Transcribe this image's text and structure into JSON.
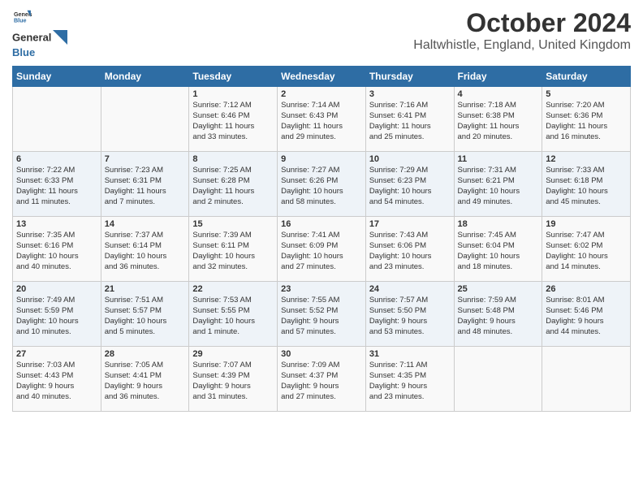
{
  "header": {
    "logo_line1": "General",
    "logo_line2": "Blue",
    "title": "October 2024",
    "subtitle": "Haltwhistle, England, United Kingdom"
  },
  "days_of_week": [
    "Sunday",
    "Monday",
    "Tuesday",
    "Wednesday",
    "Thursday",
    "Friday",
    "Saturday"
  ],
  "weeks": [
    [
      {
        "day": "",
        "content": ""
      },
      {
        "day": "",
        "content": ""
      },
      {
        "day": "1",
        "content": "Sunrise: 7:12 AM\nSunset: 6:46 PM\nDaylight: 11 hours\nand 33 minutes."
      },
      {
        "day": "2",
        "content": "Sunrise: 7:14 AM\nSunset: 6:43 PM\nDaylight: 11 hours\nand 29 minutes."
      },
      {
        "day": "3",
        "content": "Sunrise: 7:16 AM\nSunset: 6:41 PM\nDaylight: 11 hours\nand 25 minutes."
      },
      {
        "day": "4",
        "content": "Sunrise: 7:18 AM\nSunset: 6:38 PM\nDaylight: 11 hours\nand 20 minutes."
      },
      {
        "day": "5",
        "content": "Sunrise: 7:20 AM\nSunset: 6:36 PM\nDaylight: 11 hours\nand 16 minutes."
      }
    ],
    [
      {
        "day": "6",
        "content": "Sunrise: 7:22 AM\nSunset: 6:33 PM\nDaylight: 11 hours\nand 11 minutes."
      },
      {
        "day": "7",
        "content": "Sunrise: 7:23 AM\nSunset: 6:31 PM\nDaylight: 11 hours\nand 7 minutes."
      },
      {
        "day": "8",
        "content": "Sunrise: 7:25 AM\nSunset: 6:28 PM\nDaylight: 11 hours\nand 2 minutes."
      },
      {
        "day": "9",
        "content": "Sunrise: 7:27 AM\nSunset: 6:26 PM\nDaylight: 10 hours\nand 58 minutes."
      },
      {
        "day": "10",
        "content": "Sunrise: 7:29 AM\nSunset: 6:23 PM\nDaylight: 10 hours\nand 54 minutes."
      },
      {
        "day": "11",
        "content": "Sunrise: 7:31 AM\nSunset: 6:21 PM\nDaylight: 10 hours\nand 49 minutes."
      },
      {
        "day": "12",
        "content": "Sunrise: 7:33 AM\nSunset: 6:18 PM\nDaylight: 10 hours\nand 45 minutes."
      }
    ],
    [
      {
        "day": "13",
        "content": "Sunrise: 7:35 AM\nSunset: 6:16 PM\nDaylight: 10 hours\nand 40 minutes."
      },
      {
        "day": "14",
        "content": "Sunrise: 7:37 AM\nSunset: 6:14 PM\nDaylight: 10 hours\nand 36 minutes."
      },
      {
        "day": "15",
        "content": "Sunrise: 7:39 AM\nSunset: 6:11 PM\nDaylight: 10 hours\nand 32 minutes."
      },
      {
        "day": "16",
        "content": "Sunrise: 7:41 AM\nSunset: 6:09 PM\nDaylight: 10 hours\nand 27 minutes."
      },
      {
        "day": "17",
        "content": "Sunrise: 7:43 AM\nSunset: 6:06 PM\nDaylight: 10 hours\nand 23 minutes."
      },
      {
        "day": "18",
        "content": "Sunrise: 7:45 AM\nSunset: 6:04 PM\nDaylight: 10 hours\nand 18 minutes."
      },
      {
        "day": "19",
        "content": "Sunrise: 7:47 AM\nSunset: 6:02 PM\nDaylight: 10 hours\nand 14 minutes."
      }
    ],
    [
      {
        "day": "20",
        "content": "Sunrise: 7:49 AM\nSunset: 5:59 PM\nDaylight: 10 hours\nand 10 minutes."
      },
      {
        "day": "21",
        "content": "Sunrise: 7:51 AM\nSunset: 5:57 PM\nDaylight: 10 hours\nand 5 minutes."
      },
      {
        "day": "22",
        "content": "Sunrise: 7:53 AM\nSunset: 5:55 PM\nDaylight: 10 hours\nand 1 minute."
      },
      {
        "day": "23",
        "content": "Sunrise: 7:55 AM\nSunset: 5:52 PM\nDaylight: 9 hours\nand 57 minutes."
      },
      {
        "day": "24",
        "content": "Sunrise: 7:57 AM\nSunset: 5:50 PM\nDaylight: 9 hours\nand 53 minutes."
      },
      {
        "day": "25",
        "content": "Sunrise: 7:59 AM\nSunset: 5:48 PM\nDaylight: 9 hours\nand 48 minutes."
      },
      {
        "day": "26",
        "content": "Sunrise: 8:01 AM\nSunset: 5:46 PM\nDaylight: 9 hours\nand 44 minutes."
      }
    ],
    [
      {
        "day": "27",
        "content": "Sunrise: 7:03 AM\nSunset: 4:43 PM\nDaylight: 9 hours\nand 40 minutes."
      },
      {
        "day": "28",
        "content": "Sunrise: 7:05 AM\nSunset: 4:41 PM\nDaylight: 9 hours\nand 36 minutes."
      },
      {
        "day": "29",
        "content": "Sunrise: 7:07 AM\nSunset: 4:39 PM\nDaylight: 9 hours\nand 31 minutes."
      },
      {
        "day": "30",
        "content": "Sunrise: 7:09 AM\nSunset: 4:37 PM\nDaylight: 9 hours\nand 27 minutes."
      },
      {
        "day": "31",
        "content": "Sunrise: 7:11 AM\nSunset: 4:35 PM\nDaylight: 9 hours\nand 23 minutes."
      },
      {
        "day": "",
        "content": ""
      },
      {
        "day": "",
        "content": ""
      }
    ]
  ]
}
